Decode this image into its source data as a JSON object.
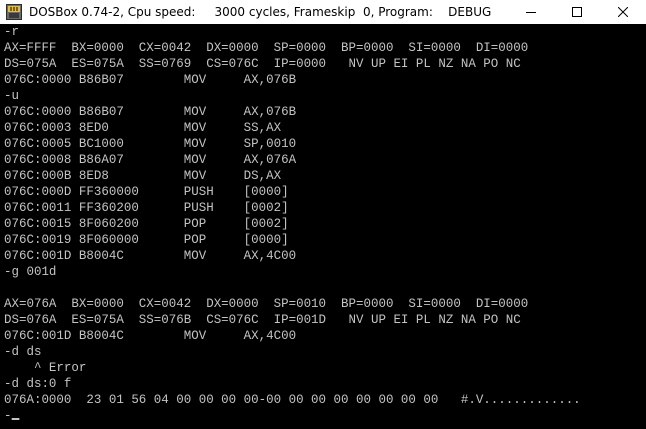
{
  "window": {
    "title": "DOSBox 0.74-2, Cpu speed:     3000 cycles, Frameskip  0, Program:    DEBUG",
    "icon": "dosbox-icon",
    "colors": {
      "titlebar_bg": "#ffffff",
      "console_bg": "#000000",
      "console_text": "#c3c3c3"
    }
  },
  "console": {
    "lines": [
      "-r",
      "AX=FFFF  BX=0000  CX=0042  DX=0000  SP=0000  BP=0000  SI=0000  DI=0000",
      "DS=075A  ES=075A  SS=0769  CS=076C  IP=0000   NV UP EI PL NZ NA PO NC",
      "076C:0000 B86B07        MOV     AX,076B",
      "-u",
      "076C:0000 B86B07        MOV     AX,076B",
      "076C:0003 8ED0          MOV     SS,AX",
      "076C:0005 BC1000        MOV     SP,0010",
      "076C:0008 B86A07        MOV     AX,076A",
      "076C:000B 8ED8          MOV     DS,AX",
      "076C:000D FF360000      PUSH    [0000]",
      "076C:0011 FF360200      PUSH    [0002]",
      "076C:0015 8F060200      POP     [0002]",
      "076C:0019 8F060000      POP     [0000]",
      "076C:001D B8004C        MOV     AX,4C00",
      "-g 001d",
      "",
      "AX=076A  BX=0000  CX=0042  DX=0000  SP=0010  BP=0000  SI=0000  DI=0000",
      "DS=076A  ES=075A  SS=076B  CS=076C  IP=001D   NV UP EI PL NZ NA PO NC",
      "076C:001D B8004C        MOV     AX,4C00",
      "-d ds",
      "    ^ Error",
      "-d ds:0 f",
      "076A:0000  23 01 56 04 00 00 00 00-00 00 00 00 00 00 00 00   #.V.............",
      "-"
    ]
  }
}
